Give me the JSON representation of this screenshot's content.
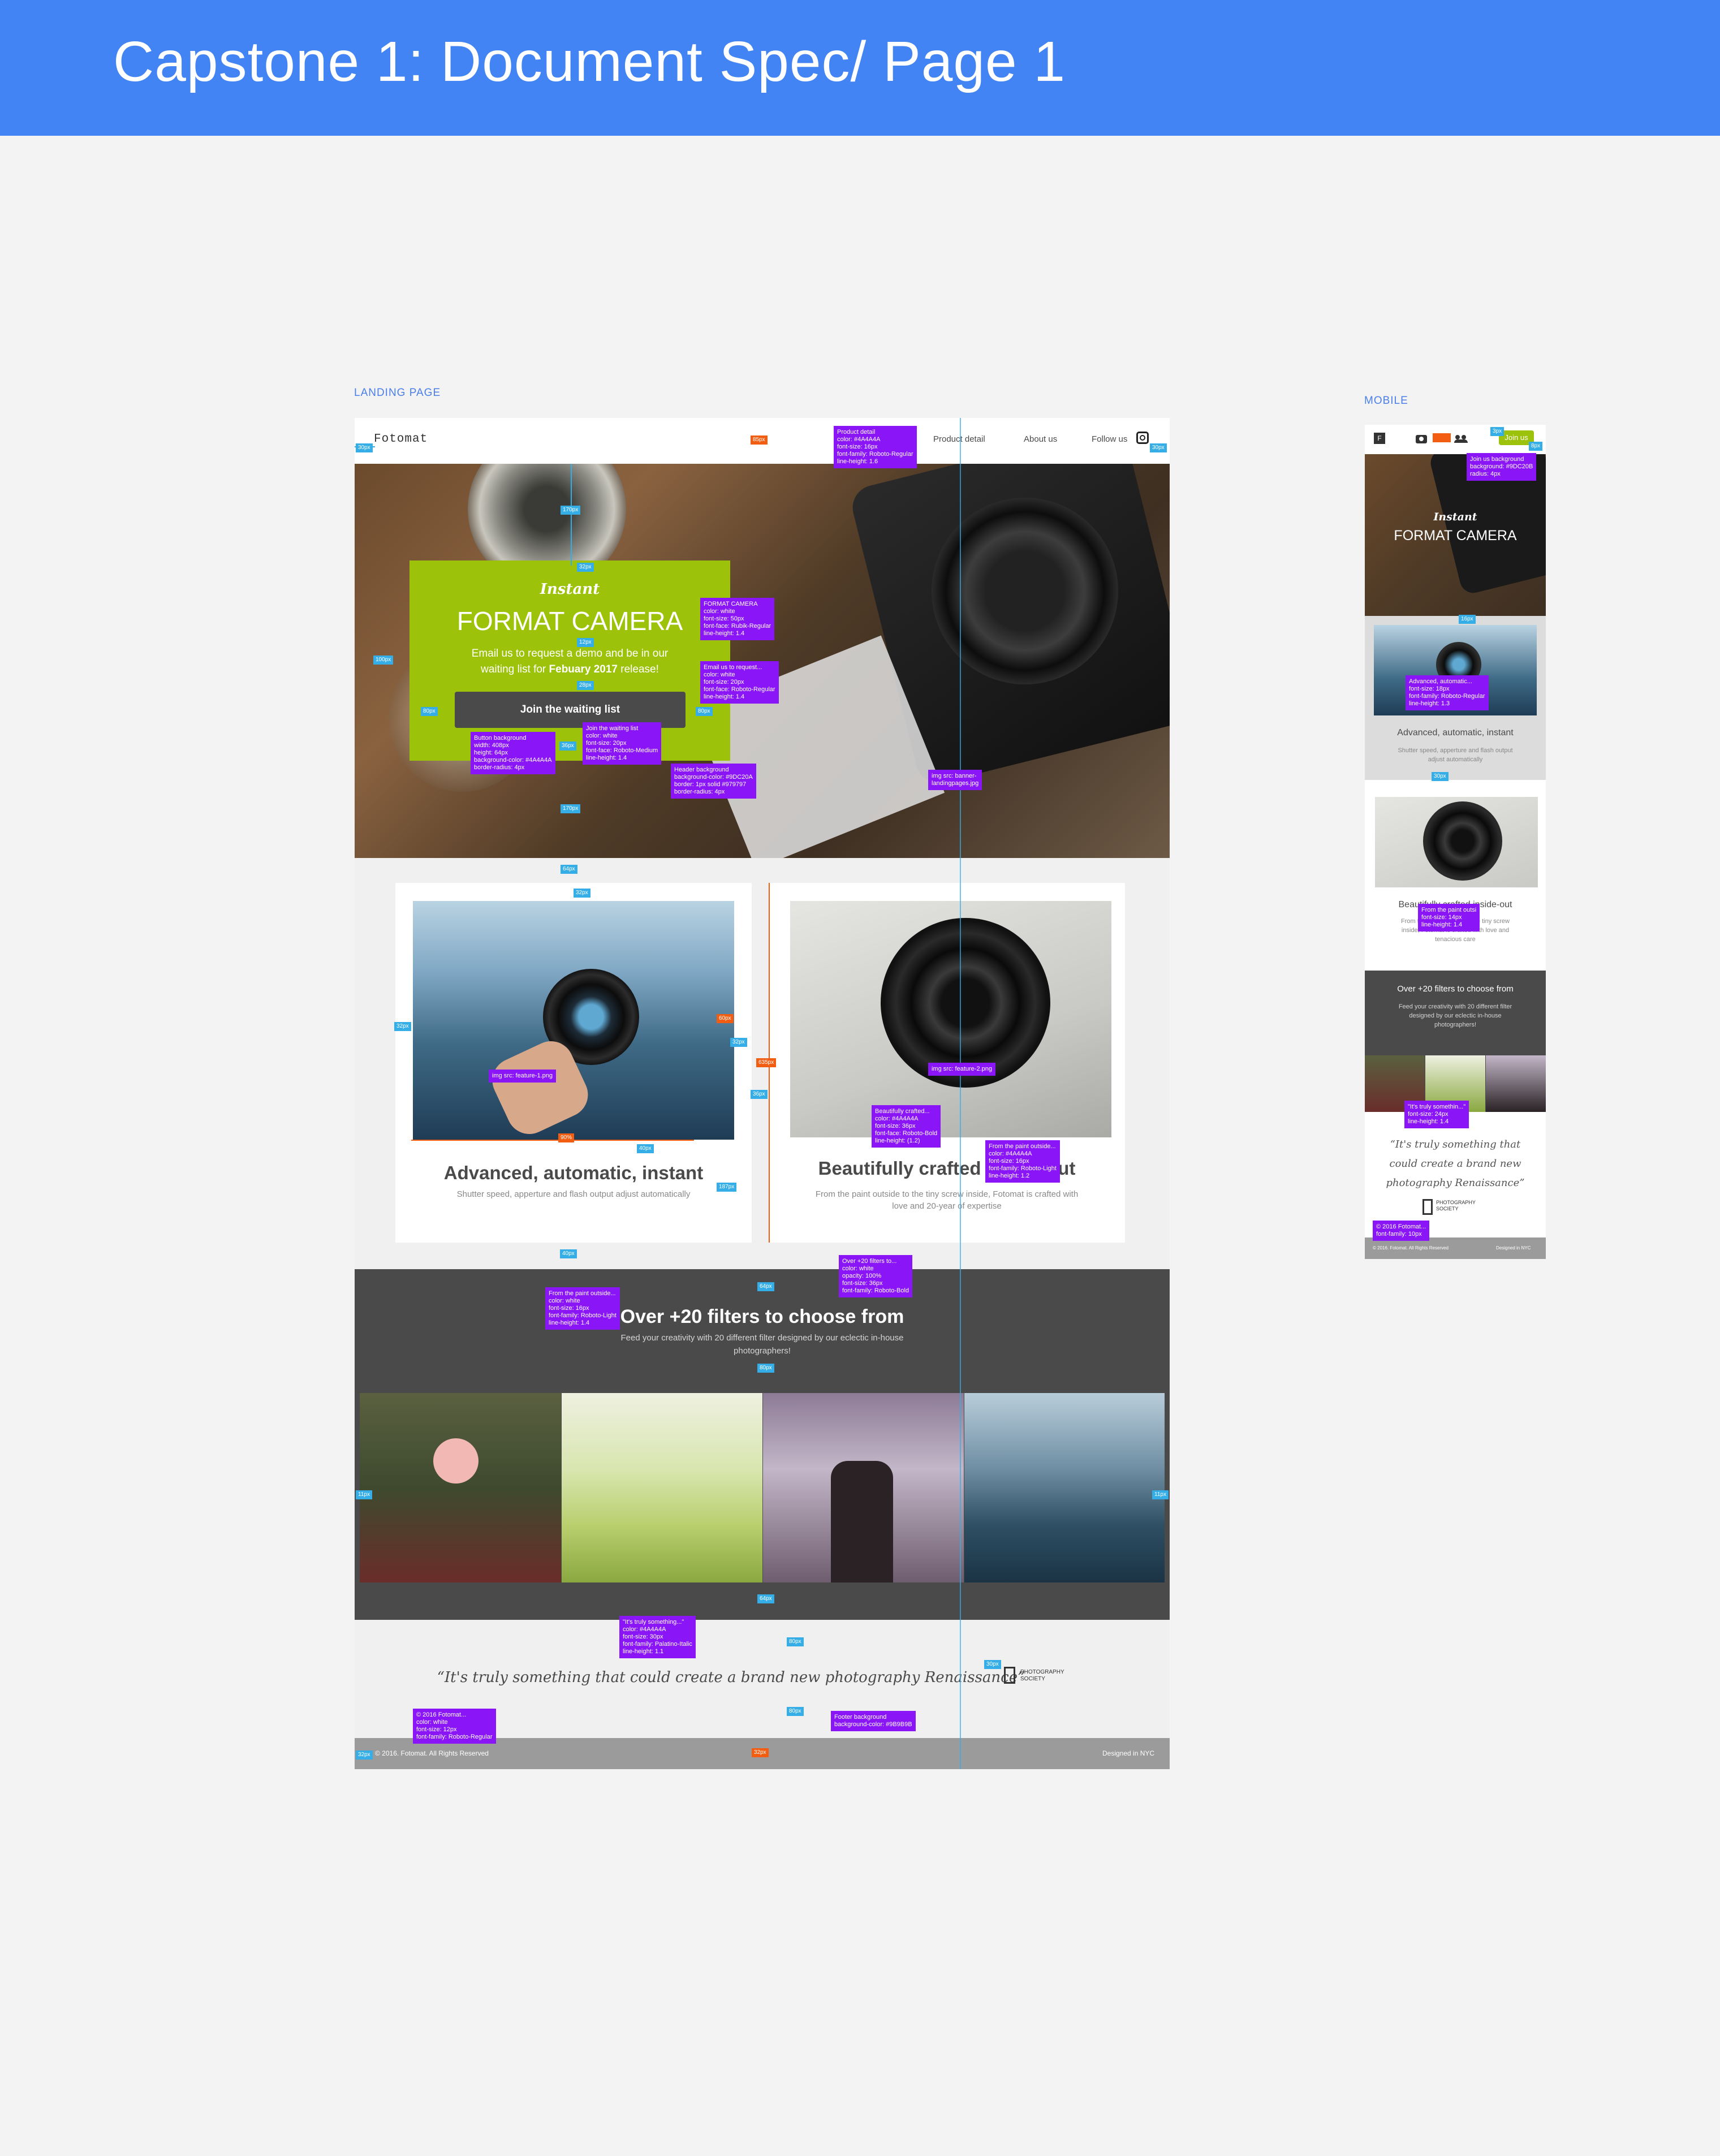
{
  "page": {
    "title": "Capstone 1: Document Spec/ Page 1"
  },
  "labels": {
    "landing": "LANDING PAGE",
    "mobile": "MOBILE"
  },
  "landing": {
    "nav": {
      "logo": "Fotomat",
      "product": "Product detail",
      "about": "About us",
      "follow": "Follow us"
    },
    "hero": {
      "script": "Instant",
      "title": "FORMAT CAMERA",
      "line1": "Email us to request a demo and be in our",
      "line2_pre": "waiting list for ",
      "line2_bold": "Febuary 2017",
      "line2_post": " release!",
      "button": "Join the waiting list"
    },
    "features": [
      {
        "title": "Advanced, automatic, instant",
        "text": "Shutter speed, apperture and flash output adjust automatically"
      },
      {
        "title": "Beautifully crafted inside-out",
        "text1": "From the paint outside to the tiny screw inside, Fotomat is crafted with",
        "text2": "love and 20-year of expertise"
      }
    ],
    "filters": {
      "title": "Over +20 filters to choose from",
      "sub1": "Feed your creativity with 20 different filter designed by our eclectic in-house",
      "sub2": "photographers!"
    },
    "quote": {
      "text": "“It's truly something that could create a brand new photography Renaissance”",
      "logo_line1": "PHOTOGRAPHY",
      "logo_line2": "SOCIETY"
    },
    "footer": {
      "copyright": "© 2016. Fotomat. All Rights Reserved",
      "designed": "Designed in NYC"
    }
  },
  "mobile": {
    "logo": "F",
    "join": "Join us",
    "hero": {
      "script": "Instant",
      "title": "FORMAT CAMERA"
    },
    "feature1": {
      "title": "Advanced, automatic, instant",
      "text1": "Shutter speed, apperture and flash output",
      "text2": "adjust automatically"
    },
    "feature2": {
      "title": "Beautifully crafted inside-out",
      "text1": "From the paint outside to the tiny screw",
      "text2": "inside, Fotomat is crafted with love and",
      "text3": "tenacious care"
    },
    "filters": {
      "title": "Over +20 filters to choose from",
      "text1": "Feed your creativity with 20 different filter",
      "text2": "designed by our eclectic in-house",
      "text3": "photographers!"
    },
    "quote": {
      "line1": "“It's truly something that",
      "line2": "could create a brand new",
      "line3": "photography Renaissance”",
      "logo_line1": "PHOTOGRAPHY",
      "logo_line2": "SOCIETY"
    },
    "footer": {
      "copyright": "© 2016. Fotomat. All Rights Reserved",
      "designed": "Designed in NYC"
    }
  },
  "specs": {
    "product_detail": "Product detail\ncolor: #4A4A4A\nfont-size: 16px\nfont-family: Roboto-Regular\nline-height: 1.6",
    "format_camera": "FORMAT CAMERA\ncolor: white\nfont-size: 50px\nfont-face: Rubik-Regular\nline-height: 1.4",
    "email_us": "Email us to request...\ncolor: white\nfont-size: 20px\nfont-face: Roboto-Regular\nline-height: 1.4",
    "button_bg": "Button background\nwidth: 408px\nheight: 64px\nbackground-color: #4A4A4A\nborder-radius: 4px",
    "join_list": "Join the waiting list\ncolor: white\nfont-size: 20px\nfont-face: Roboto-Medium\nline-height: 1.4",
    "header_bg": "Header background\nbackground-color: #9DC20A\nborder: 1px solid #979797\nborder-radius: 4px",
    "banner_img": "img src: banner-\nlandingpages.jpg",
    "feature1_img": "img src: feature-1.png",
    "feature2_img": "img src: feature-2.png",
    "beautifully": "Beautifully crafted...\ncolor: #4A4A4A\nfont-size: 36px\nfont-face: Roboto-Bold\nline-height: (1.2)",
    "paint_outside": "From the paint outside...\ncolor: #4A4A4A\nfont-size: 16px\nfont-family: Roboto-Light\nline-height: 1.2",
    "over20": "Over +20 filters to...\ncolor: white\nopacity: 100%\nfont-size: 36px\nfont-family: Roboto-Bold",
    "paint_white": "From the paint outside...\ncolor: white\nfont-size: 16px\nfont-family: Roboto-Light\nline-height: 1.4",
    "truly": "\"It's truly something...\"\ncolor: #4A4A4A\nfont-size: 30px\nfont-family: Palatino-Italic\nline-height: 1.1",
    "footer_copy": "© 2016 Fotomat...\ncolor: white\nfont-size: 12px\nfont-family: Roboto-Regular",
    "footer_bg": "Footer background\nbackground-color: #9B9B9B",
    "m_join": "Join us background\nbackground: #9DC20B\nradius: 4px",
    "m_advanced": "Advanced, automatic...\nfont-size: 18px\nfont-family: Roboto-Regular\nline-height: 1.3",
    "m_paint": "From the paint outsi\nfont-size: 14px\nline-height: 1.4",
    "m_truly": "\"It's truly somethin...\"\nfont-size: 24px\nline-height: 1.4",
    "m_footer": "© 2016 Fotomat...\nfont-family: 10px"
  },
  "measures": {
    "p85": "85px",
    "p30": "30px",
    "p170": "170px",
    "p32": "32px",
    "p100": "100px",
    "p12": "12px",
    "p28": "28px",
    "p80": "80px",
    "p36": "36px",
    "p64": "64px",
    "p60": "60px",
    "p187": "187px",
    "p635": "635px",
    "p40": "40px",
    "p11": "11px",
    "p3": "3px",
    "p8": "8px",
    "p16": "16px",
    "p4": "4px",
    "p90": "90%"
  },
  "colors": {
    "header_green": "#9DC20A",
    "button": "#4A4A4A",
    "footer": "#9B9B9B",
    "spec": "#8A16F7",
    "measure": "#35AEE8",
    "measure_orange": "#F25D12",
    "topbar": "#4284F3"
  }
}
